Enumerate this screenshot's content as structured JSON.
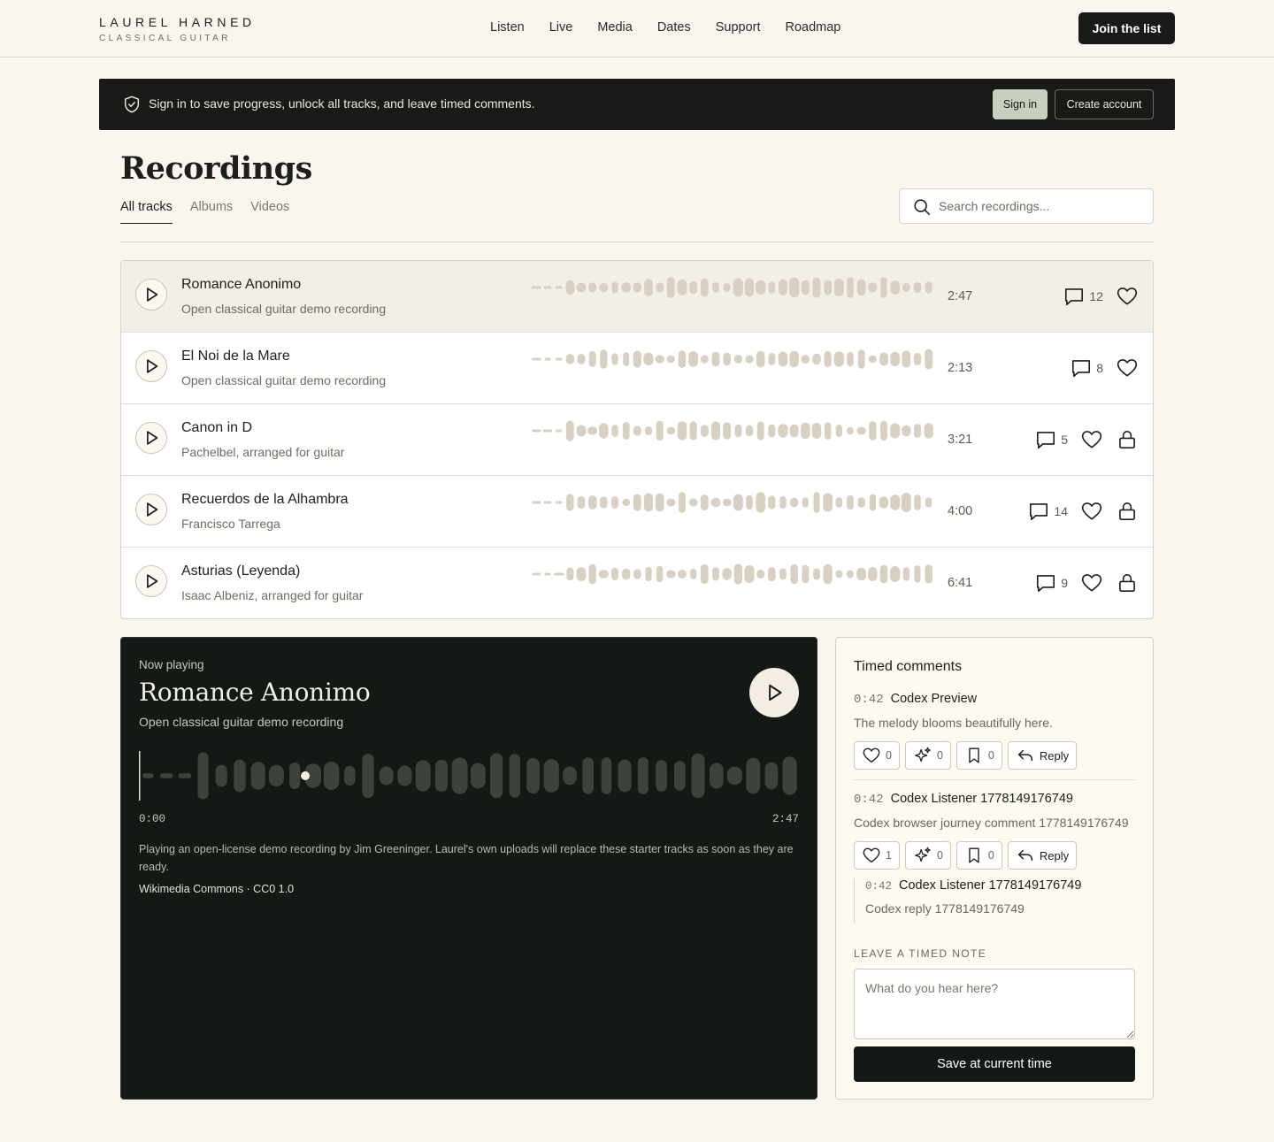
{
  "brand": {
    "name": "LAUREL HARNED",
    "tagline": "CLASSICAL GUITAR"
  },
  "nav": [
    "Listen",
    "Live",
    "Media",
    "Dates",
    "Support",
    "Roadmap"
  ],
  "header": {
    "cta_label": "Join the list"
  },
  "banner": {
    "icon": "shield-check-icon",
    "text": "Sign in to save progress, unlock all tracks, and leave timed comments.",
    "signin_label": "Sign in",
    "create_label": "Create account"
  },
  "page": {
    "title": "Recordings",
    "tabs": [
      "All tracks",
      "Albums",
      "Videos"
    ],
    "active_tab": "All tracks",
    "search_placeholder": "Search recordings...",
    "search_value": ""
  },
  "tracks": [
    {
      "title": "Romance Anonimo",
      "subtitle": "Open classical guitar demo recording",
      "duration": "2:47",
      "comments": "12",
      "locked": false,
      "active": true
    },
    {
      "title": "El Noi de la Mare",
      "subtitle": "Open classical guitar demo recording",
      "duration": "2:13",
      "comments": "8",
      "locked": false,
      "active": false
    },
    {
      "title": "Canon in D",
      "subtitle": "Pachelbel, arranged for guitar",
      "duration": "3:21",
      "comments": "5",
      "locked": true,
      "active": false
    },
    {
      "title": "Recuerdos de la Alhambra",
      "subtitle": "Francisco Tarrega",
      "duration": "4:00",
      "comments": "14",
      "locked": true,
      "active": false
    },
    {
      "title": "Asturias (Leyenda)",
      "subtitle": "Isaac Albeniz, arranged for guitar",
      "duration": "6:41",
      "comments": "9",
      "locked": true,
      "active": false
    }
  ],
  "player": {
    "label": "Now playing",
    "title": "Romance Anonimo",
    "subtitle": "Open classical guitar demo recording",
    "time_current": "0:00",
    "time_total": "2:47",
    "progress": 0.0,
    "note": "Playing an open-license demo recording by Jim Greeninger. Laurel's own uploads will replace these starter tracks as soon as they are ready.",
    "credit": "Wikimedia Commons · CC0 1.0"
  },
  "comments": {
    "title": "Timed comments",
    "items": [
      {
        "time": "0:42",
        "author": "Codex Preview",
        "body": "The melody blooms beautifully here.",
        "likes": "0",
        "sparkles": "0",
        "saves": "0",
        "reply_label": "Reply"
      },
      {
        "time": "0:42",
        "author": "Codex Listener 1778149176749",
        "body": "Codex browser journey comment 1778149176749",
        "likes": "1",
        "sparkles": "0",
        "saves": "0",
        "reply_label": "Reply"
      }
    ],
    "reply": {
      "time": "0:42",
      "author": "Codex Listener 1778149176749",
      "body": "Codex reply 1778149176749"
    },
    "note_label": "LEAVE A TIMED NOTE",
    "note_placeholder": "What do you hear here?",
    "save_label": "Save at current time"
  },
  "colors": {
    "ink": "#171a16",
    "paper": "#faf6ef",
    "wave": "#d8d1c3",
    "player_bg": "#141915",
    "player_wave": "#3b433b"
  }
}
